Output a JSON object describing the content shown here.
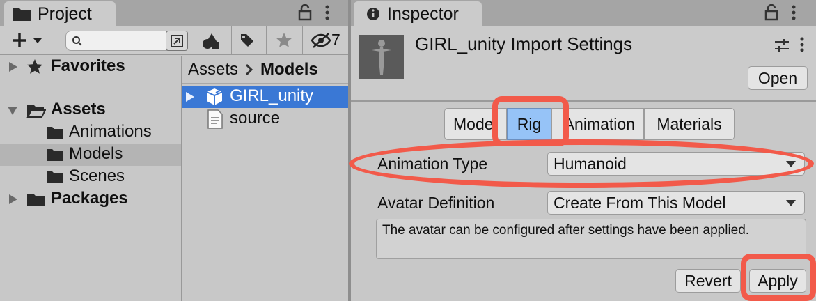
{
  "project": {
    "tab_title": "Project",
    "hidden_count": "7",
    "search": {
      "value": "",
      "placeholder": ""
    },
    "tree": {
      "favorites": "Favorites",
      "assets": "Assets",
      "children": [
        "Animations",
        "Models",
        "Scenes"
      ],
      "packages": "Packages"
    },
    "breadcrumb": {
      "root": "Assets",
      "current": "Models"
    },
    "files": [
      "GIRL_unity",
      "source"
    ]
  },
  "inspector": {
    "tab_title": "Inspector",
    "title": "GIRL_unity Import Settings",
    "open_label": "Open",
    "tabs": [
      "Model",
      "Rig",
      "Animation",
      "Materials"
    ],
    "active_tab": "Rig",
    "animation_type": {
      "label": "Animation Type",
      "value": "Humanoid"
    },
    "avatar_definition": {
      "label": "Avatar Definition",
      "value": "Create From This Model"
    },
    "help_text": "The avatar can be configured after settings have been applied.",
    "revert_label": "Revert",
    "apply_label": "Apply"
  },
  "colors": {
    "highlight": "#f25a4a",
    "selection": "#3a78d5",
    "active_tab": "#96c3f7"
  }
}
